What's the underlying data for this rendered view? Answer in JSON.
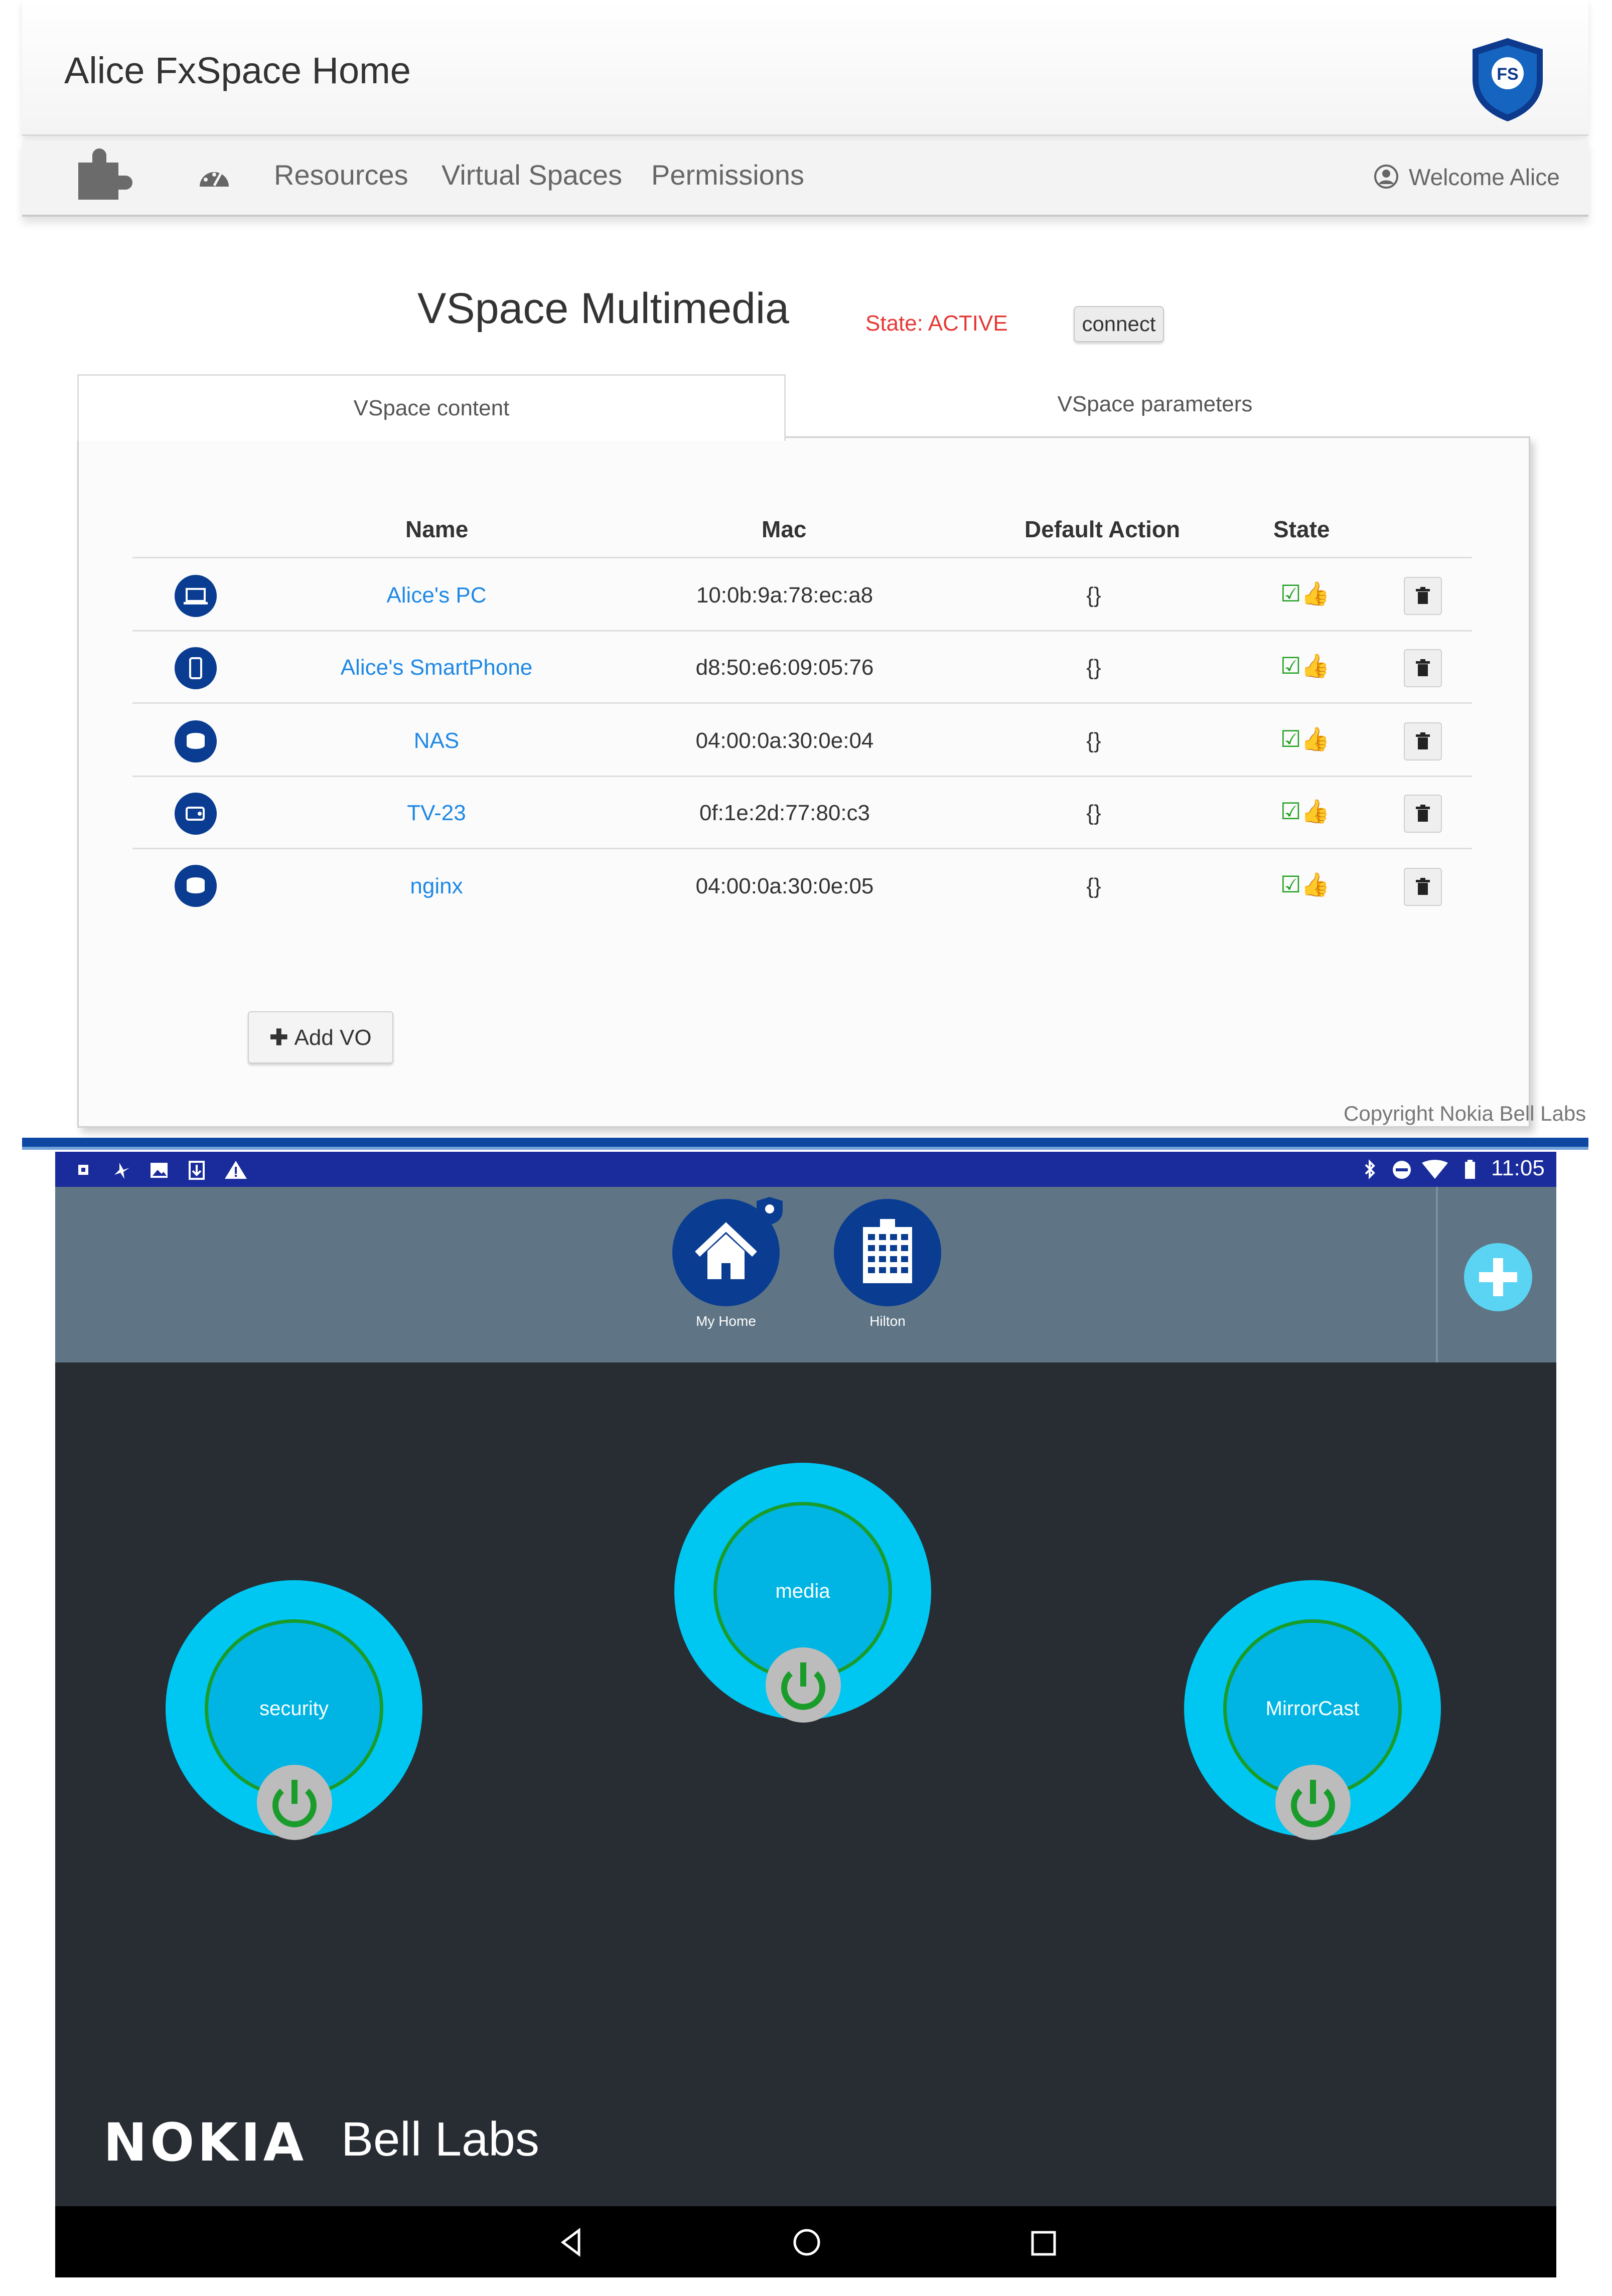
{
  "app": {
    "title": "Alice FxSpace Home",
    "logo_text": "FS"
  },
  "nav": {
    "links": [
      "Resources",
      "Virtual Spaces",
      "Permissions"
    ],
    "welcome": "Welcome Alice"
  },
  "vspace": {
    "title": "VSpace Multimedia",
    "state": "State: ACTIVE",
    "connect_label": "connect",
    "tabs": [
      "VSpace content",
      "VSpace parameters"
    ],
    "columns": {
      "name": "Name",
      "mac": "Mac",
      "default_action": "Default Action",
      "state": "State"
    },
    "rows": [
      {
        "icon": "laptop-icon",
        "name": "Alice's PC",
        "mac": "10:0b:9a:78:ec:a8",
        "action": "{}"
      },
      {
        "icon": "smartphone-icon",
        "name": "Alice's SmartPhone",
        "mac": "d8:50:e6:09:05:76",
        "action": "{}"
      },
      {
        "icon": "database-icon",
        "name": "NAS",
        "mac": "04:00:0a:30:0e:04",
        "action": "{}"
      },
      {
        "icon": "tv-icon",
        "name": "TV-23",
        "mac": "0f:1e:2d:77:80:c3",
        "action": "{}"
      },
      {
        "icon": "database-icon",
        "name": "nginx",
        "mac": "04:00:0a:30:0e:05",
        "action": "{}"
      }
    ],
    "add_label": "Add VO",
    "copyright": "Copyright Nokia Bell Labs"
  },
  "tablet": {
    "time": "11:05",
    "spaces": [
      {
        "label": "My Home",
        "icon": "house-icon"
      },
      {
        "label": "Hilton",
        "icon": "hotel-icon"
      }
    ],
    "virtual_spaces": [
      "security",
      "media",
      "MirrorCast"
    ],
    "brand": {
      "nokia": "NOKIA",
      "bell_labs": "Bell Labs"
    }
  },
  "colors": {
    "accent_blue": "#0a3d91",
    "cyan": "#00c7f2",
    "state_red": "#e53935",
    "ok_green": "#1b9e1b"
  }
}
